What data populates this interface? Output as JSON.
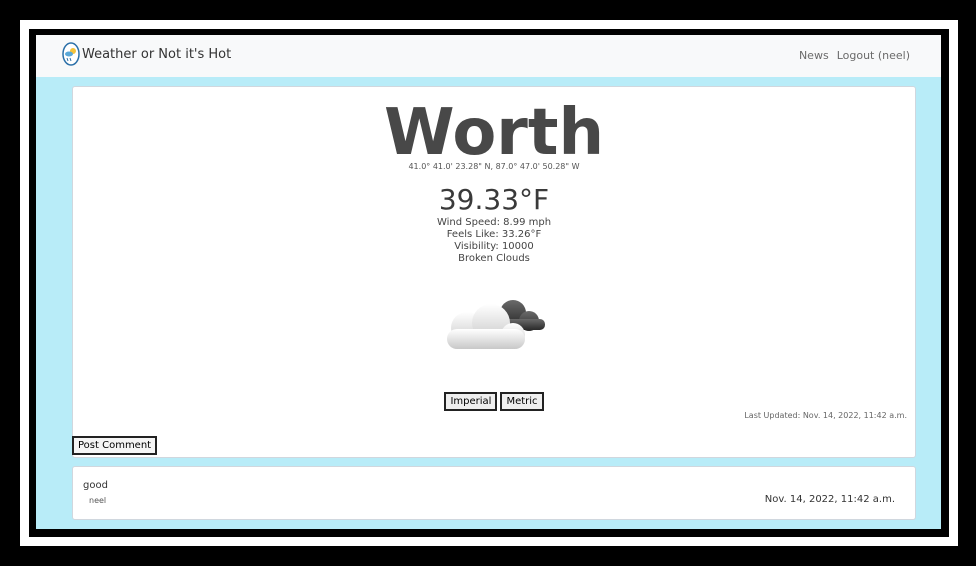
{
  "navbar": {
    "brand": "Weather or Not it's Hot",
    "links": [
      {
        "label": "News"
      },
      {
        "label": "Logout (neel)"
      }
    ]
  },
  "weather": {
    "city": "Worth",
    "coordinates": "41.0° 41.0' 23.28\" N, 87.0° 47.0' 50.28\" W",
    "temperature": "39.33°F",
    "wind_speed": "Wind Speed: 8.99 mph",
    "feels_like": "Feels Like: 33.26°F",
    "visibility": "Visibility: 10000",
    "condition": "Broken Clouds",
    "icon": "broken-clouds-icon"
  },
  "units": {
    "imperial_label": "Imperial",
    "metric_label": "Metric"
  },
  "last_updated": "Last Updated: Nov. 14, 2022, 11:42 a.m.",
  "post_comment_label": "Post Comment",
  "comments": [
    {
      "text": "good",
      "user": "neel",
      "date": "Nov. 14, 2022, 11:42 a.m."
    }
  ],
  "colors": {
    "page_background": "#b8ecf8",
    "navbar_background": "#f8f9fa",
    "frame": "#000000"
  }
}
